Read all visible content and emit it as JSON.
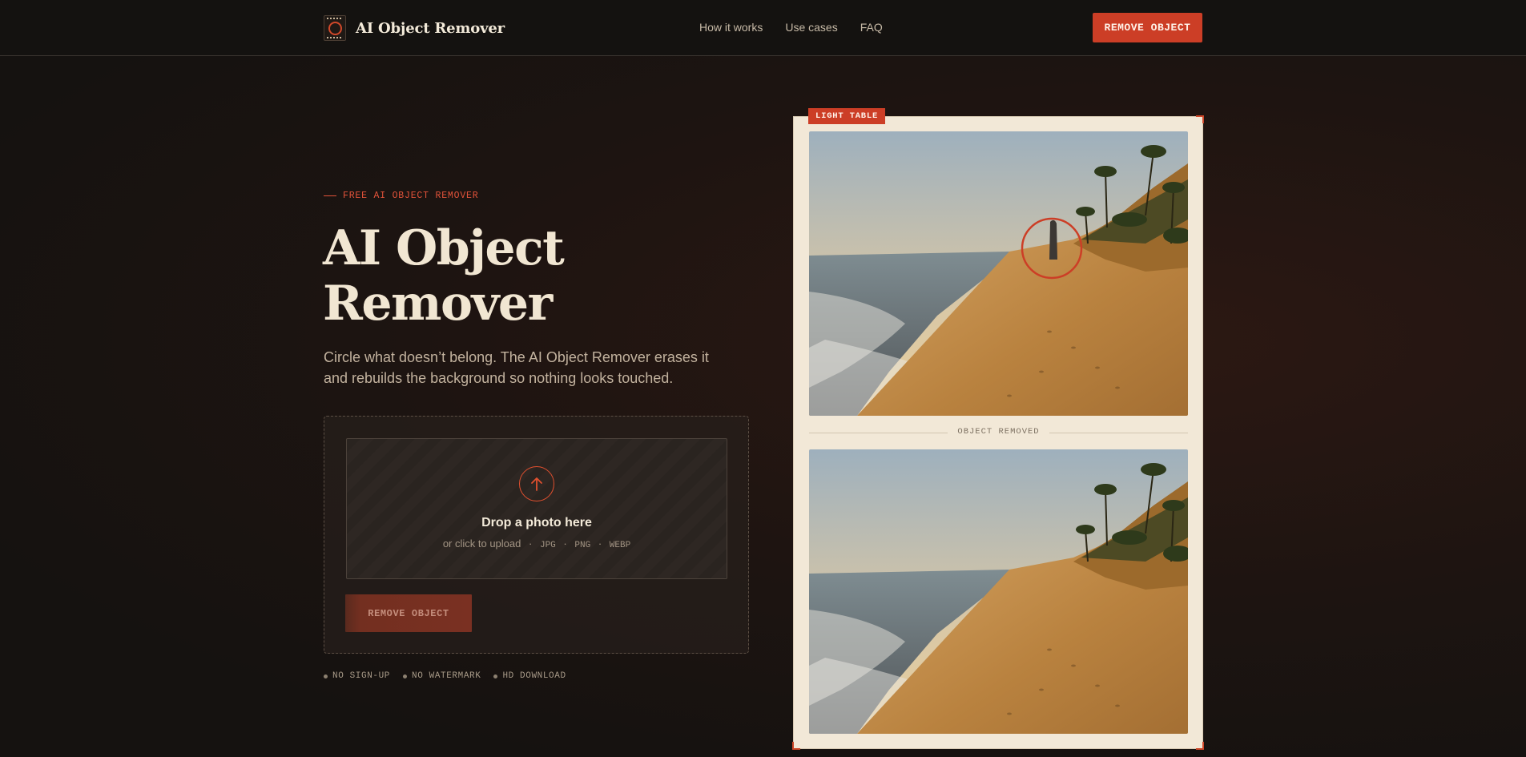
{
  "header": {
    "brand": "AI Object Remover",
    "nav": [
      "How it works",
      "Use cases",
      "FAQ"
    ],
    "cta": "REMOVE OBJECT"
  },
  "hero": {
    "eyebrow": "FREE AI OBJECT REMOVER",
    "title_line1": "AI Object",
    "title_line2": "Remover",
    "subtitle": "Circle what doesn’t belong. The AI Object Remover erases it and rebuilds the background so nothing looks touched."
  },
  "upload": {
    "title": "Drop a photo here",
    "subtitle": "or click to upload",
    "formats": [
      "JPG",
      "PNG",
      "WEBP"
    ],
    "button": "REMOVE OBJECT"
  },
  "perks": [
    "NO SIGN-UP",
    "NO WATERMARK",
    "HD DOWNLOAD"
  ],
  "preview": {
    "badge": "LIGHT TABLE",
    "divider": "OBJECT REMOVED"
  },
  "colors": {
    "accent": "#cc3e26",
    "background": "#151210",
    "paper": "#f2e8d7"
  }
}
